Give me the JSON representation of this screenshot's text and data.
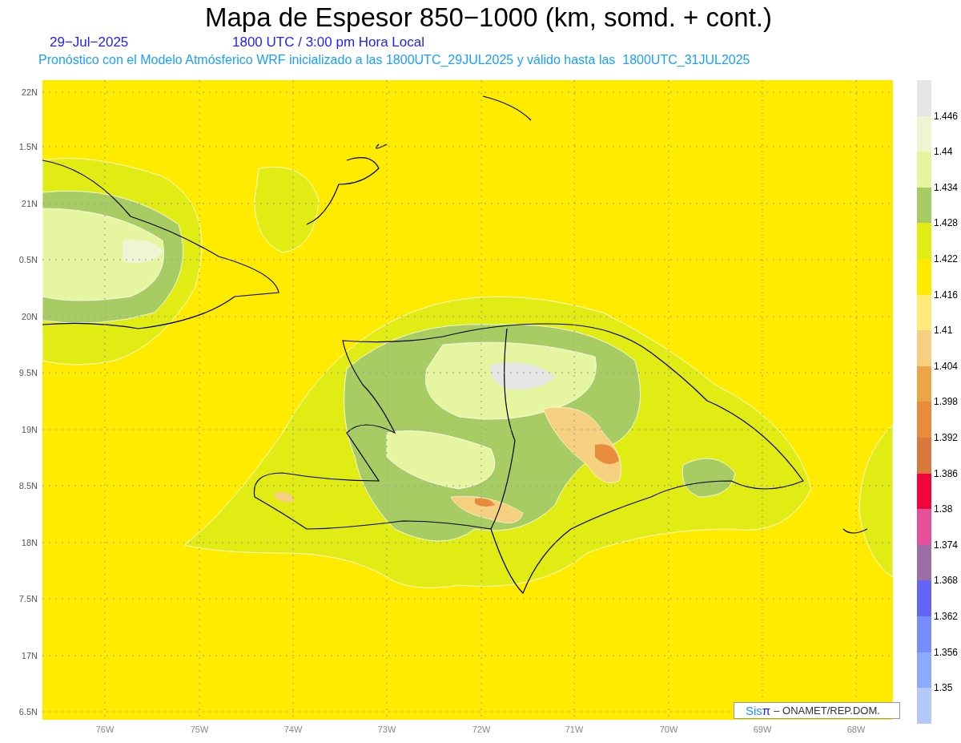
{
  "title": "Mapa de Espesor 850−1000 (km, somd. + cont.)",
  "date": "29−Jul−2025",
  "time": "1800 UTC / 3:00 pm Hora Local",
  "subtitle": "Pronóstico con el Modelo Atmósferico WRF inicializado a las 1800UTC_29JUL2025 y válido hasta las  1800UTC_31JUL2025",
  "y_axis": [
    "22N",
    "1.5N",
    "21N",
    "0.5N",
    "20N",
    "9.5N",
    "19N",
    "8.5N",
    "18N",
    "7.5N",
    "17N",
    "6.5N"
  ],
  "x_axis": [
    "76W",
    "75W",
    "74W",
    "73W",
    "72W",
    "71W",
    "70W",
    "69W",
    "68W"
  ],
  "credit": {
    "logo_a": "Sis",
    "logo_b": "π",
    "text": "– ONAMET/REP.DOM."
  },
  "legend": [
    {
      "color": "#e6e6e6",
      "label": "1.446"
    },
    {
      "color": "#eef5d2",
      "label": "1.44"
    },
    {
      "color": "#e6f5a0",
      "label": "1.434"
    },
    {
      "color": "#a8cc64",
      "label": "1.428"
    },
    {
      "color": "#e1eb14",
      "label": "1.422"
    },
    {
      "color": "#ffeb00",
      "label": "1.416"
    },
    {
      "color": "#ffe978",
      "label": "1.41"
    },
    {
      "color": "#f5d080",
      "label": "1.404"
    },
    {
      "color": "#eba548",
      "label": "1.398"
    },
    {
      "color": "#e68c3c",
      "label": "1.392"
    },
    {
      "color": "#d7783c",
      "label": "1.386"
    },
    {
      "color": "#f0053c",
      "label": "1.38"
    },
    {
      "color": "#e6509b",
      "label": "1.374"
    },
    {
      "color": "#9b6ea5",
      "label": "1.368"
    },
    {
      "color": "#6464f5",
      "label": "1.362"
    },
    {
      "color": "#788cfa",
      "label": "1.356"
    },
    {
      "color": "#8caafa",
      "label": "1.35"
    },
    {
      "color": "#b4c8fa"
    }
  ]
}
